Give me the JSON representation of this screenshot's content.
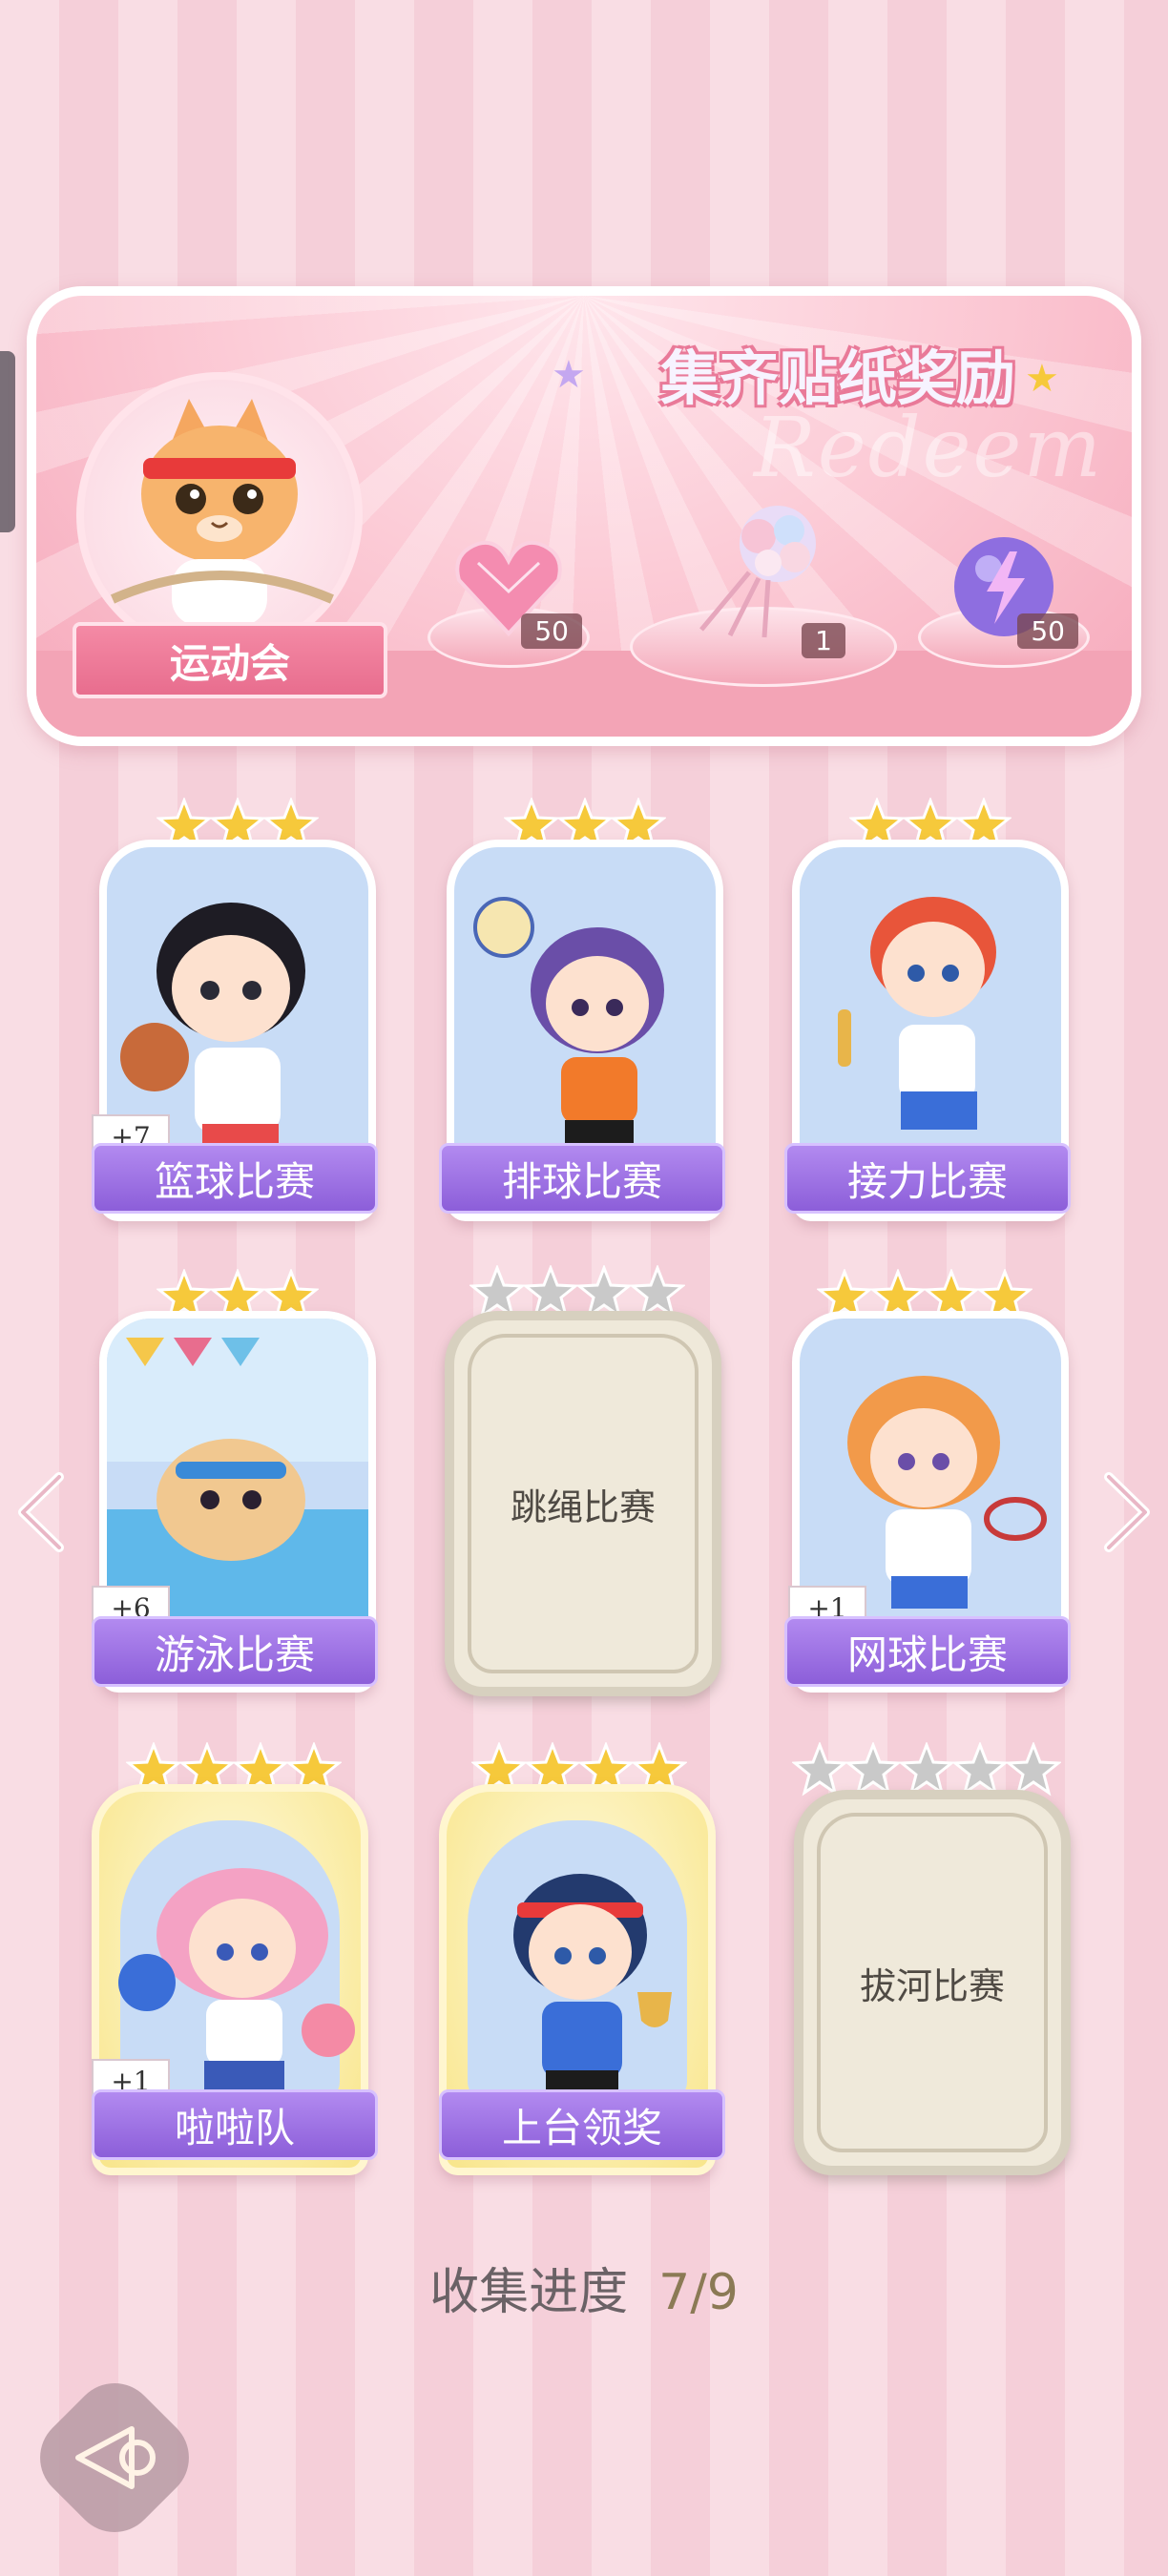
{
  "reward": {
    "title": "集齐贴纸奖励",
    "watermark": "Redeem",
    "event_name": "运动会",
    "items": [
      {
        "icon": "pink-heart-gem-icon",
        "count": "50"
      },
      {
        "icon": "flower-bouquet-icon",
        "count": "1"
      },
      {
        "icon": "purple-energy-orb-icon",
        "count": "50"
      }
    ]
  },
  "cards": [
    {
      "label": "篮球比赛",
      "stars": 3,
      "collected": true,
      "bonus": "+7"
    },
    {
      "label": "排球比赛",
      "stars": 3,
      "collected": true,
      "bonus": ""
    },
    {
      "label": "接力比赛",
      "stars": 3,
      "collected": true,
      "bonus": ""
    },
    {
      "label": "游泳比赛",
      "stars": 3,
      "collected": true,
      "bonus": "+6"
    },
    {
      "label": "跳绳比赛",
      "stars": 4,
      "collected": false,
      "bonus": ""
    },
    {
      "label": "网球比赛",
      "stars": 4,
      "collected": true,
      "bonus": "+1"
    },
    {
      "label": "啦啦队",
      "stars": 4,
      "collected": true,
      "bonus": "+1"
    },
    {
      "label": "上台领奖",
      "stars": 4,
      "collected": true,
      "bonus": ""
    },
    {
      "label": "拔河比赛",
      "stars": 5,
      "collected": false,
      "bonus": ""
    }
  ],
  "progress": {
    "label": "收集进度",
    "value": "7/9"
  },
  "colors": {
    "label_purple": "#8c5ed9",
    "star_gold": "#f6c93b",
    "star_gray": "#c9c9c9",
    "panel_pink": "#f6a9bb"
  }
}
